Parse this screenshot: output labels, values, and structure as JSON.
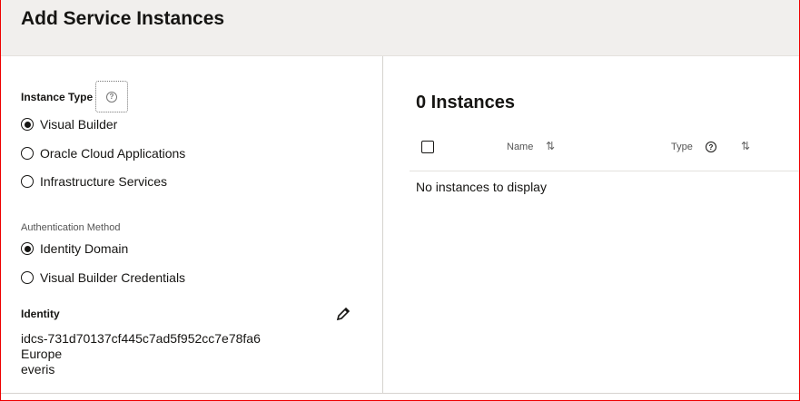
{
  "header": {
    "title": "Add Service Instances"
  },
  "instance_type": {
    "label": "Instance Type",
    "options": [
      {
        "label": "Visual Builder",
        "selected": true
      },
      {
        "label": "Oracle Cloud Applications",
        "selected": false
      },
      {
        "label": "Infrastructure Services",
        "selected": false
      }
    ]
  },
  "auth": {
    "label": "Authentication Method",
    "options": [
      {
        "label": "Identity Domain",
        "selected": true
      },
      {
        "label": "Visual Builder Credentials",
        "selected": false
      }
    ]
  },
  "identity": {
    "label": "Identity",
    "id": "idcs-731d70137cf445c7ad5f952cc7e78fa6",
    "region": "Europe",
    "name": "everis"
  },
  "instances": {
    "title": "0 Instances",
    "columns": [
      "Name",
      "Type"
    ],
    "sort_glyph": "⇅",
    "empty": "No instances to display"
  }
}
